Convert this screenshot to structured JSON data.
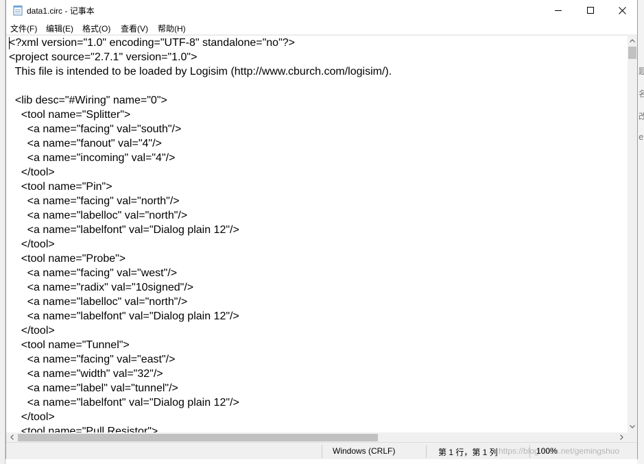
{
  "window": {
    "title": "data1.circ - 记事本",
    "icon": "notepad-icon"
  },
  "menu": {
    "items": [
      "文件(F)",
      "编辑(E)",
      "格式(O)",
      "查看(V)",
      "帮助(H)"
    ]
  },
  "editor": {
    "lines": [
      "<?xml version=\"1.0\" encoding=\"UTF-8\" standalone=\"no\"?>",
      "<project source=\"2.7.1\" version=\"1.0\">",
      "  This file is intended to be loaded by Logisim (http://www.cburch.com/logisim/).",
      "",
      "  <lib desc=\"#Wiring\" name=\"0\">",
      "    <tool name=\"Splitter\">",
      "      <a name=\"facing\" val=\"south\"/>",
      "      <a name=\"fanout\" val=\"4\"/>",
      "      <a name=\"incoming\" val=\"4\"/>",
      "    </tool>",
      "    <tool name=\"Pin\">",
      "      <a name=\"facing\" val=\"north\"/>",
      "      <a name=\"labelloc\" val=\"north\"/>",
      "      <a name=\"labelfont\" val=\"Dialog plain 12\"/>",
      "    </tool>",
      "    <tool name=\"Probe\">",
      "      <a name=\"facing\" val=\"west\"/>",
      "      <a name=\"radix\" val=\"10signed\"/>",
      "      <a name=\"labelloc\" val=\"north\"/>",
      "      <a name=\"labelfont\" val=\"Dialog plain 12\"/>",
      "    </tool>",
      "    <tool name=\"Tunnel\">",
      "      <a name=\"facing\" val=\"east\"/>",
      "      <a name=\"width\" val=\"32\"/>",
      "      <a name=\"label\" val=\"tunnel\"/>",
      "      <a name=\"labelfont\" val=\"Dialog plain 12\"/>",
      "    </tool>",
      "    <tool name=\"Pull Resistor\">"
    ]
  },
  "status": {
    "line_ending": "Windows (CRLF)",
    "position": "第 1 行，第 1 列",
    "zoom": "100%",
    "watermark": "https://blog.csdn.net/gemingshuo"
  },
  "background_window": {
    "fragments": [
      "题",
      "名",
      "改",
      "er"
    ]
  },
  "colors": {
    "scrollbar_track": "#f0f0f0",
    "scrollbar_thumb": "#c1c1c1",
    "statusbar": "#f0f0f0"
  }
}
